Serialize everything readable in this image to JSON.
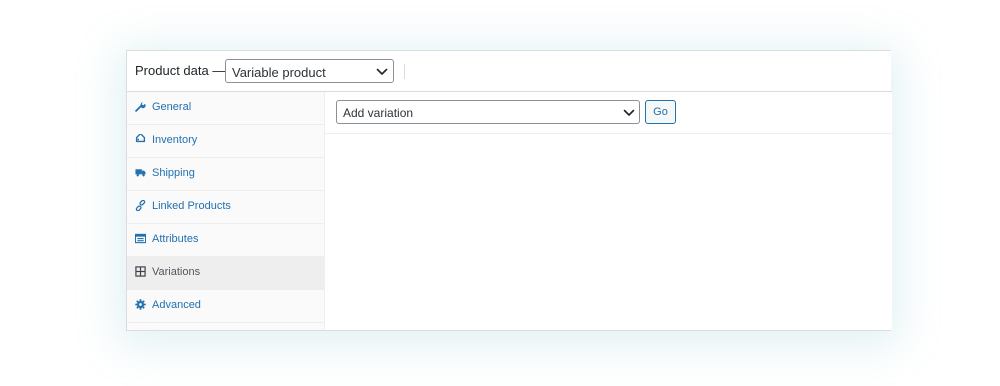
{
  "header": {
    "label": "Product data —",
    "product_type": {
      "selected": "Variable product"
    }
  },
  "tabs": [
    {
      "label": "General",
      "icon": "wrench-icon",
      "active": false
    },
    {
      "label": "Inventory",
      "icon": "tag-icon",
      "active": false
    },
    {
      "label": "Shipping",
      "icon": "truck-icon",
      "active": false
    },
    {
      "label": "Linked Products",
      "icon": "link-icon",
      "active": false
    },
    {
      "label": "Attributes",
      "icon": "list-icon",
      "active": false
    },
    {
      "label": "Variations",
      "icon": "grid-icon",
      "active": true
    },
    {
      "label": "Advanced",
      "icon": "gear-icon",
      "active": false
    }
  ],
  "variations": {
    "select": {
      "selected": "Add variation"
    },
    "go_label": "Go"
  },
  "colors": {
    "link": "#2271b1",
    "active_text": "#50575e",
    "active_tab_bg": "#eeeeee",
    "border": "#dcdcde"
  }
}
